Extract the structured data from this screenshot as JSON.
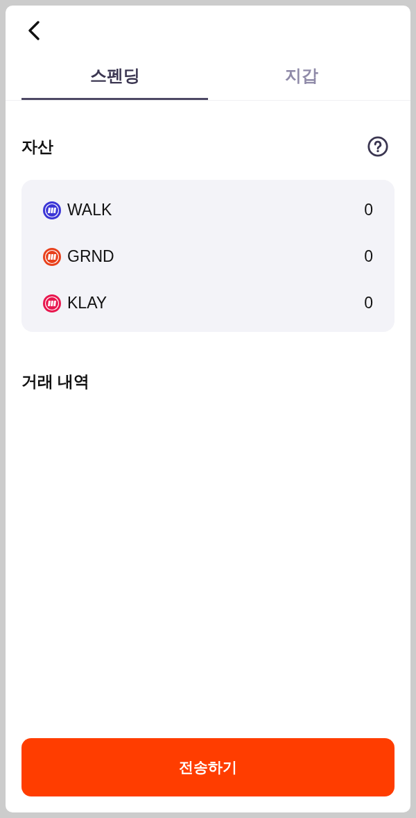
{
  "tabs": [
    {
      "label": "스펜딩",
      "selected": true
    },
    {
      "label": "지갑",
      "selected": false
    }
  ],
  "assets": {
    "title": "자산",
    "items": [
      {
        "symbol": "WALK",
        "amount": "0",
        "color": "#3b35d6"
      },
      {
        "symbol": "GRND",
        "amount": "0",
        "color": "#e8401c"
      },
      {
        "symbol": "KLAY",
        "amount": "0",
        "color": "#e8174f"
      }
    ]
  },
  "history": {
    "title": "거래 내역"
  },
  "send_button": {
    "label": "전송하기"
  }
}
